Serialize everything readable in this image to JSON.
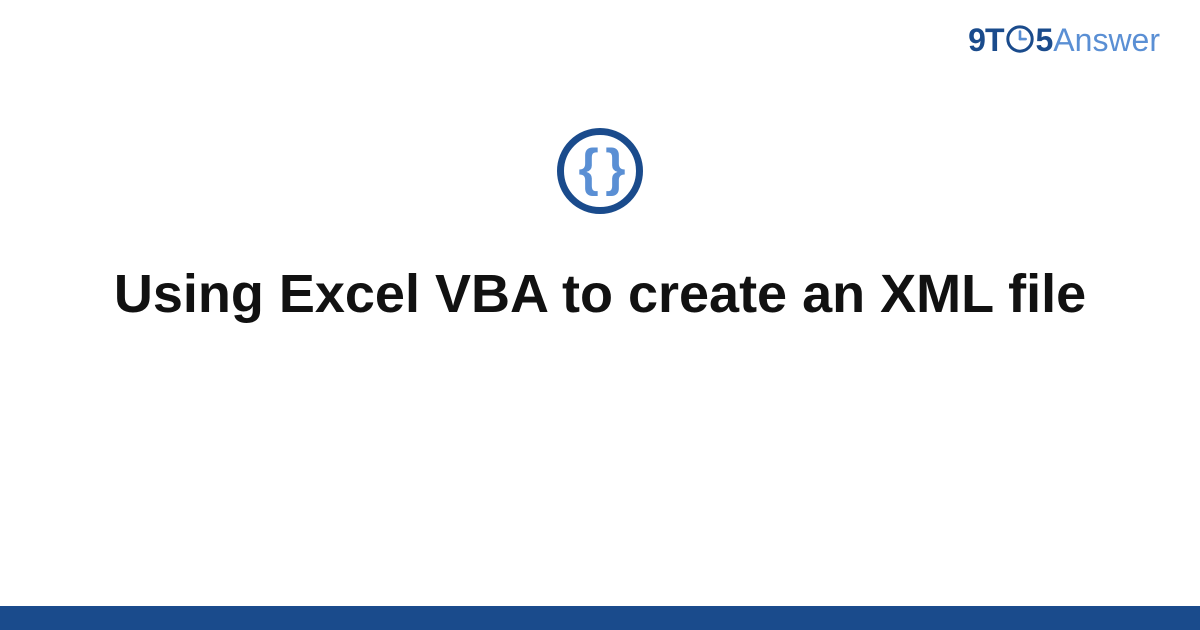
{
  "brand": {
    "part1": "9T",
    "part2": "5",
    "part3": "Answer"
  },
  "icon": {
    "glyph": "{ }"
  },
  "title": "Using Excel VBA to create an XML file",
  "colors": {
    "primary": "#1a4b8c",
    "accent": "#5a8fd4",
    "text": "#111111",
    "background": "#ffffff"
  }
}
